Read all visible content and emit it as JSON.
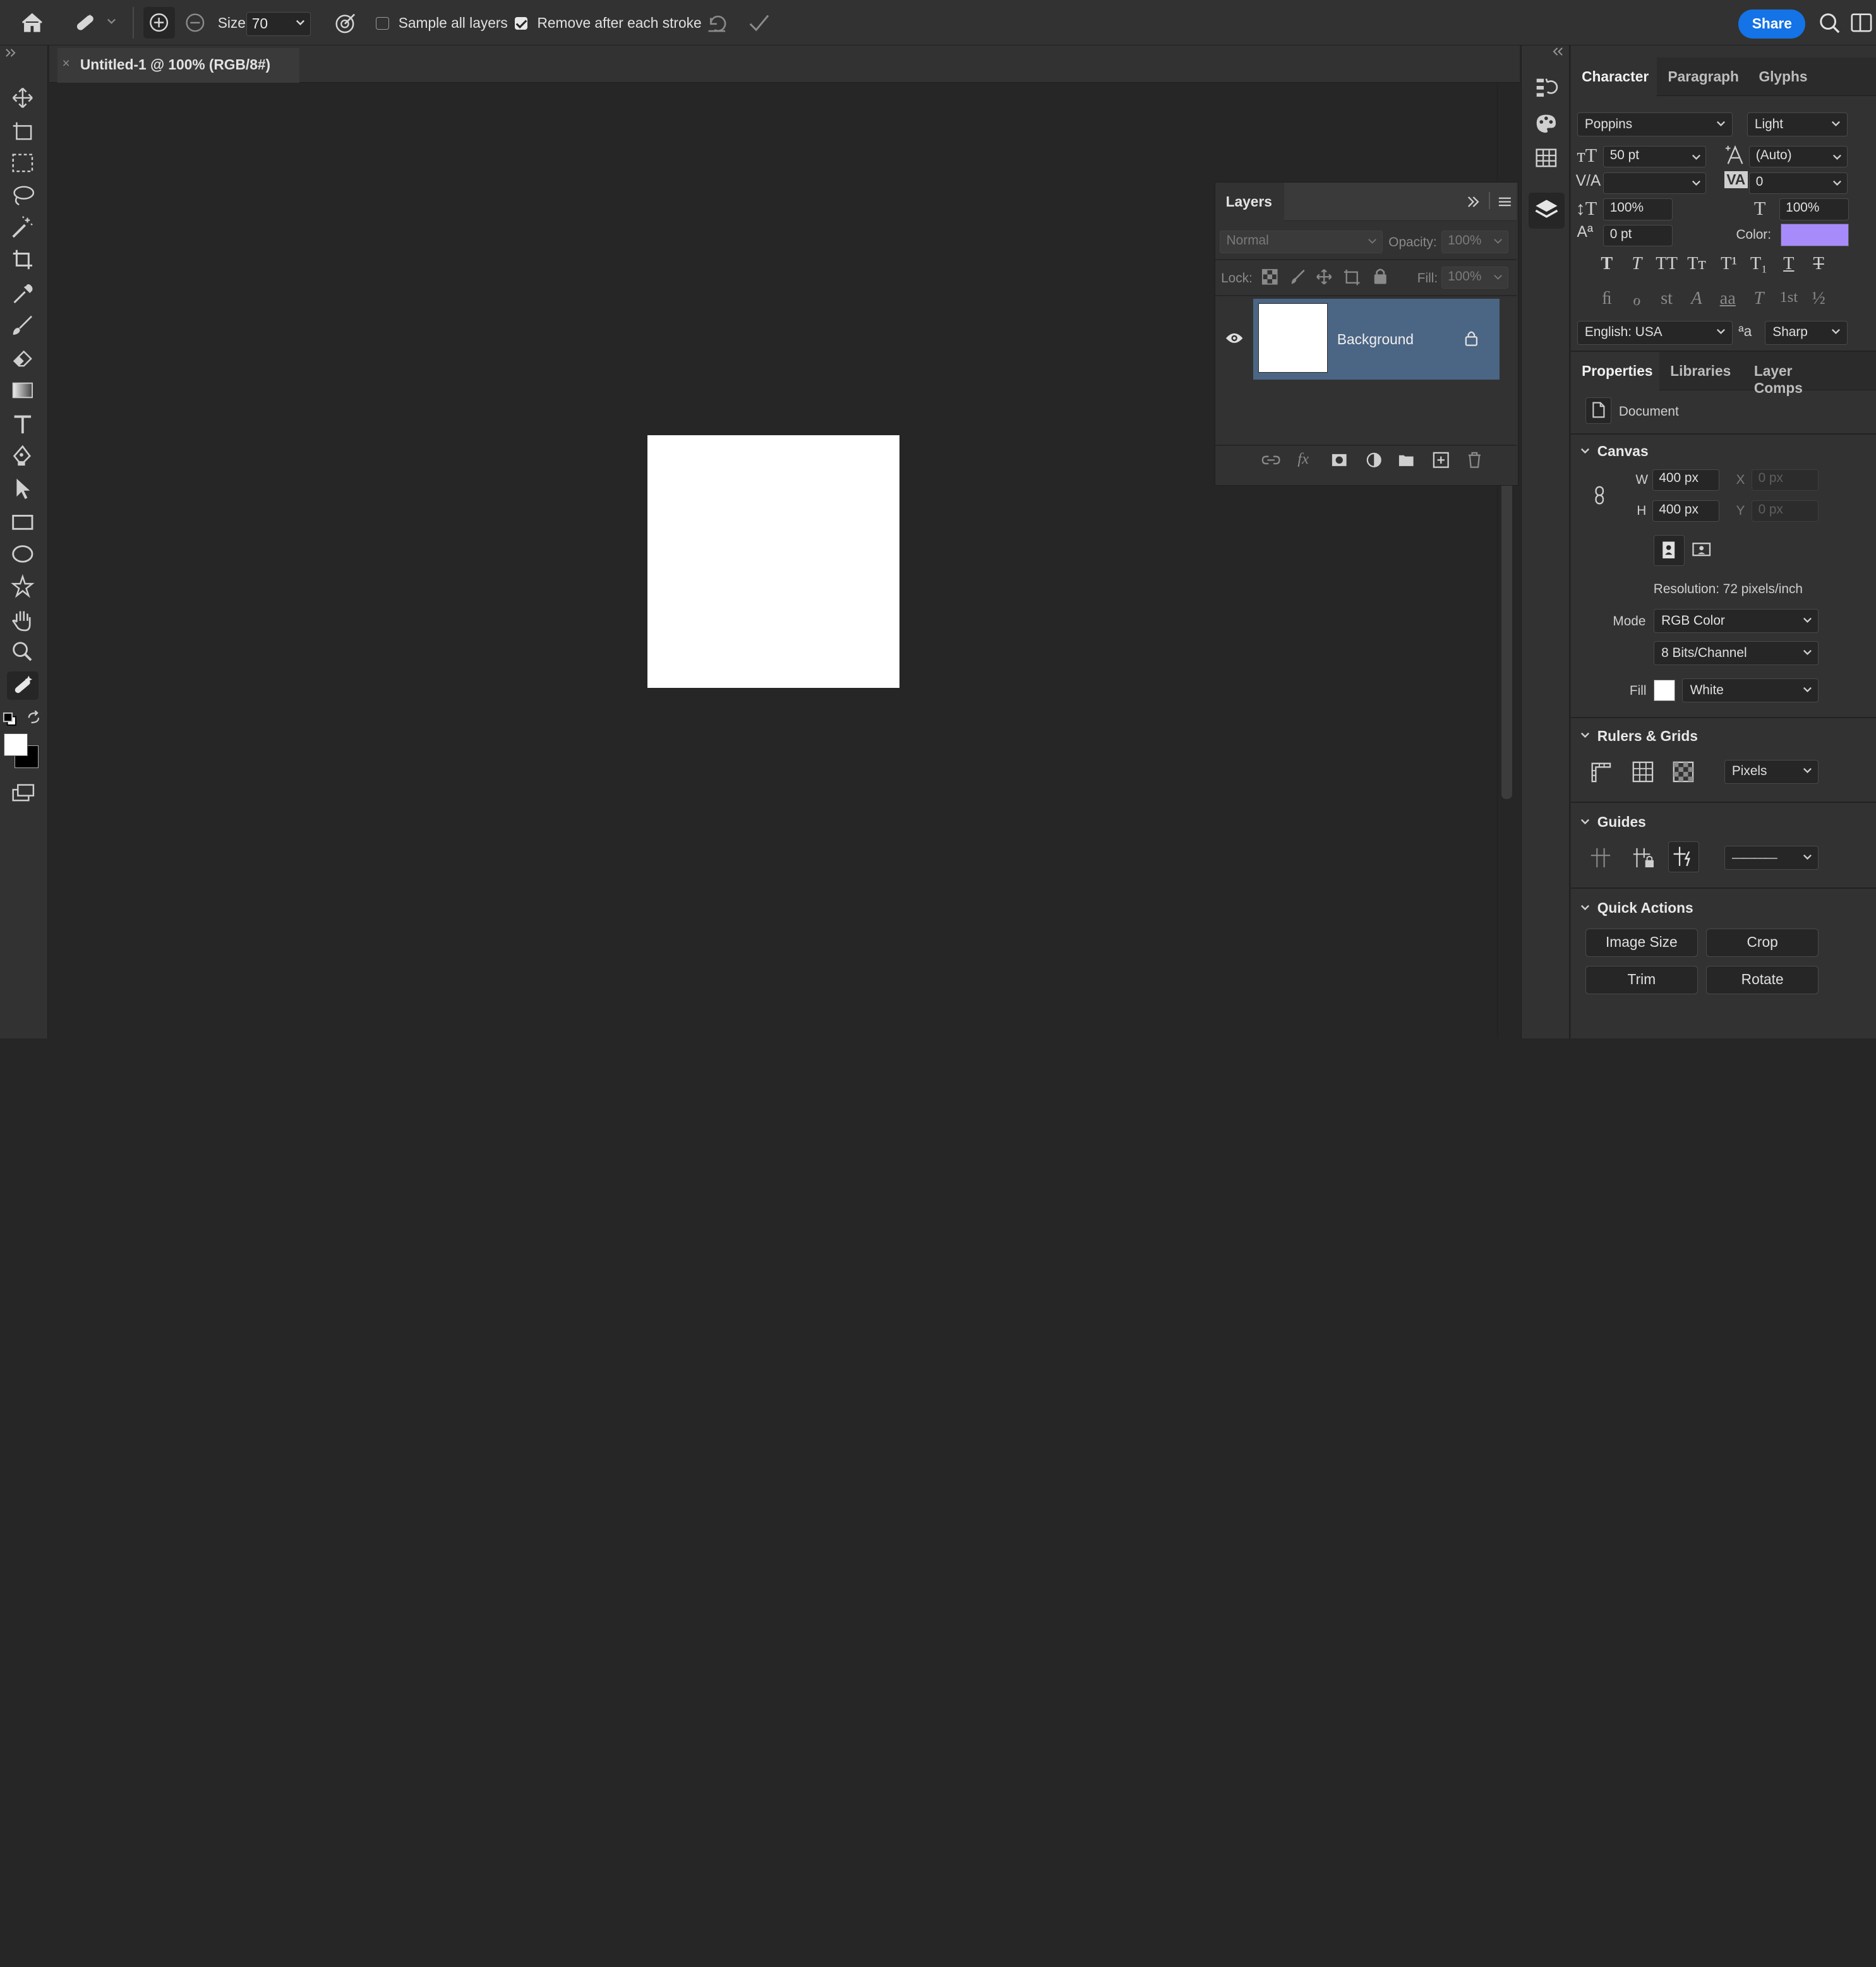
{
  "options_bar": {
    "size_label": "Size",
    "size_value": "70",
    "sample_all_layers_label": "Sample all layers",
    "sample_all_layers_checked": false,
    "remove_after_stroke_label": "Remove after each stroke",
    "remove_after_stroke_checked": true,
    "share_label": "Share"
  },
  "document": {
    "tab_title": "Untitled-1 @ 100% (RGB/8#)",
    "close_glyph": "×",
    "canvas_color": "#ffffff"
  },
  "layers_panel": {
    "title": "Layers",
    "blend_mode": "Normal",
    "opacity_label": "Opacity:",
    "opacity_value": "100%",
    "lock_label": "Lock:",
    "fill_label": "Fill:",
    "fill_value": "100%",
    "layers": [
      {
        "name": "Background",
        "visible": true,
        "locked": true,
        "thumbnail_color": "#ffffff"
      }
    ]
  },
  "character_panel": {
    "tabs": [
      "Character",
      "Paragraph",
      "Glyphs"
    ],
    "font_family": "Poppins",
    "font_style": "Light",
    "font_size": "50 pt",
    "leading": "(Auto)",
    "kerning": "",
    "tracking": "0",
    "vertical_scale": "100%",
    "horizontal_scale": "100%",
    "baseline_shift": "0 pt",
    "color_label": "Color:",
    "color_value": "#a78bfa",
    "type_styles": [
      "T",
      "T",
      "TT",
      "Tт",
      "T¹",
      "T₁",
      "T",
      "T"
    ],
    "opentype": [
      "ﬁ",
      "ℴ",
      "st",
      "A",
      "aa",
      "T",
      "1st",
      "½"
    ],
    "language": "English: USA",
    "aa_glyph": "ªa",
    "antialias": "Sharp"
  },
  "properties_panel": {
    "tabs": [
      "Properties",
      "Libraries",
      "Layer Comps"
    ],
    "doc_label": "Document",
    "canvas_section": "Canvas",
    "w_label": "W",
    "w_value": "400 px",
    "h_label": "H",
    "h_value": "400 px",
    "x_label": "X",
    "x_placeholder": "0 px",
    "y_label": "Y",
    "y_placeholder": "0 px",
    "resolution": "Resolution: 72 pixels/inch",
    "mode_label": "Mode",
    "mode_value": "RGB Color",
    "bits_value": "8 Bits/Channel",
    "fill_label": "Fill",
    "fill_value": "White",
    "fill_swatch": "#ffffff",
    "rulers_section": "Rulers & Grids",
    "units_value": "Pixels",
    "guides_section": "Guides",
    "guide_line_value": "————",
    "quick_actions_section": "Quick Actions",
    "quick_actions": [
      "Image Size",
      "Crop",
      "Trim",
      "Rotate"
    ]
  }
}
